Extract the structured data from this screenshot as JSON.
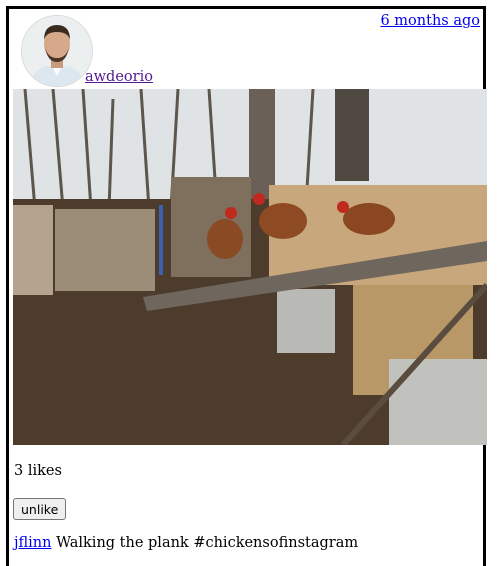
{
  "post": {
    "owner": "awdeorio",
    "timestamp": "6 months ago",
    "avatar_icon": "profile-photo",
    "image_icon": "chickens-photo",
    "likes_text": "3 likes",
    "unlike_label": "unlike",
    "comments": [
      {
        "author": "jflinn",
        "text": "Walking the plank #chickensofinstagram"
      }
    ]
  },
  "colors": {
    "link": "#0000ee",
    "visited_link": "#551a8b",
    "border": "#000000"
  }
}
